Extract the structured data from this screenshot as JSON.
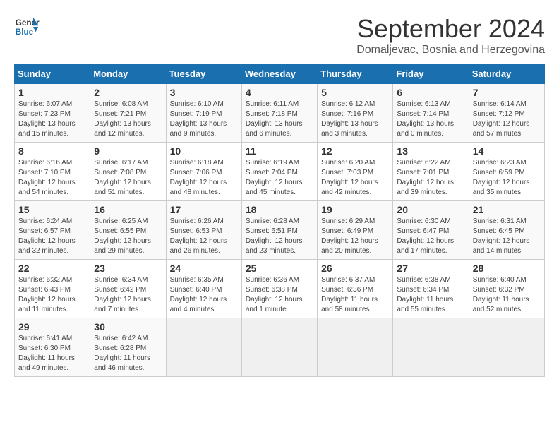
{
  "header": {
    "logo_line1": "General",
    "logo_line2": "Blue",
    "month_title": "September 2024",
    "location": "Domaljevac, Bosnia and Herzegovina"
  },
  "weekdays": [
    "Sunday",
    "Monday",
    "Tuesday",
    "Wednesday",
    "Thursday",
    "Friday",
    "Saturday"
  ],
  "weeks": [
    [
      {
        "day": "1",
        "sunrise": "Sunrise: 6:07 AM",
        "sunset": "Sunset: 7:23 PM",
        "daylight": "Daylight: 13 hours and 15 minutes."
      },
      {
        "day": "2",
        "sunrise": "Sunrise: 6:08 AM",
        "sunset": "Sunset: 7:21 PM",
        "daylight": "Daylight: 13 hours and 12 minutes."
      },
      {
        "day": "3",
        "sunrise": "Sunrise: 6:10 AM",
        "sunset": "Sunset: 7:19 PM",
        "daylight": "Daylight: 13 hours and 9 minutes."
      },
      {
        "day": "4",
        "sunrise": "Sunrise: 6:11 AM",
        "sunset": "Sunset: 7:18 PM",
        "daylight": "Daylight: 13 hours and 6 minutes."
      },
      {
        "day": "5",
        "sunrise": "Sunrise: 6:12 AM",
        "sunset": "Sunset: 7:16 PM",
        "daylight": "Daylight: 13 hours and 3 minutes."
      },
      {
        "day": "6",
        "sunrise": "Sunrise: 6:13 AM",
        "sunset": "Sunset: 7:14 PM",
        "daylight": "Daylight: 13 hours and 0 minutes."
      },
      {
        "day": "7",
        "sunrise": "Sunrise: 6:14 AM",
        "sunset": "Sunset: 7:12 PM",
        "daylight": "Daylight: 12 hours and 57 minutes."
      }
    ],
    [
      {
        "day": "8",
        "sunrise": "Sunrise: 6:16 AM",
        "sunset": "Sunset: 7:10 PM",
        "daylight": "Daylight: 12 hours and 54 minutes."
      },
      {
        "day": "9",
        "sunrise": "Sunrise: 6:17 AM",
        "sunset": "Sunset: 7:08 PM",
        "daylight": "Daylight: 12 hours and 51 minutes."
      },
      {
        "day": "10",
        "sunrise": "Sunrise: 6:18 AM",
        "sunset": "Sunset: 7:06 PM",
        "daylight": "Daylight: 12 hours and 48 minutes."
      },
      {
        "day": "11",
        "sunrise": "Sunrise: 6:19 AM",
        "sunset": "Sunset: 7:04 PM",
        "daylight": "Daylight: 12 hours and 45 minutes."
      },
      {
        "day": "12",
        "sunrise": "Sunrise: 6:20 AM",
        "sunset": "Sunset: 7:03 PM",
        "daylight": "Daylight: 12 hours and 42 minutes."
      },
      {
        "day": "13",
        "sunrise": "Sunrise: 6:22 AM",
        "sunset": "Sunset: 7:01 PM",
        "daylight": "Daylight: 12 hours and 39 minutes."
      },
      {
        "day": "14",
        "sunrise": "Sunrise: 6:23 AM",
        "sunset": "Sunset: 6:59 PM",
        "daylight": "Daylight: 12 hours and 35 minutes."
      }
    ],
    [
      {
        "day": "15",
        "sunrise": "Sunrise: 6:24 AM",
        "sunset": "Sunset: 6:57 PM",
        "daylight": "Daylight: 12 hours and 32 minutes."
      },
      {
        "day": "16",
        "sunrise": "Sunrise: 6:25 AM",
        "sunset": "Sunset: 6:55 PM",
        "daylight": "Daylight: 12 hours and 29 minutes."
      },
      {
        "day": "17",
        "sunrise": "Sunrise: 6:26 AM",
        "sunset": "Sunset: 6:53 PM",
        "daylight": "Daylight: 12 hours and 26 minutes."
      },
      {
        "day": "18",
        "sunrise": "Sunrise: 6:28 AM",
        "sunset": "Sunset: 6:51 PM",
        "daylight": "Daylight: 12 hours and 23 minutes."
      },
      {
        "day": "19",
        "sunrise": "Sunrise: 6:29 AM",
        "sunset": "Sunset: 6:49 PM",
        "daylight": "Daylight: 12 hours and 20 minutes."
      },
      {
        "day": "20",
        "sunrise": "Sunrise: 6:30 AM",
        "sunset": "Sunset: 6:47 PM",
        "daylight": "Daylight: 12 hours and 17 minutes."
      },
      {
        "day": "21",
        "sunrise": "Sunrise: 6:31 AM",
        "sunset": "Sunset: 6:45 PM",
        "daylight": "Daylight: 12 hours and 14 minutes."
      }
    ],
    [
      {
        "day": "22",
        "sunrise": "Sunrise: 6:32 AM",
        "sunset": "Sunset: 6:43 PM",
        "daylight": "Daylight: 12 hours and 11 minutes."
      },
      {
        "day": "23",
        "sunrise": "Sunrise: 6:34 AM",
        "sunset": "Sunset: 6:42 PM",
        "daylight": "Daylight: 12 hours and 7 minutes."
      },
      {
        "day": "24",
        "sunrise": "Sunrise: 6:35 AM",
        "sunset": "Sunset: 6:40 PM",
        "daylight": "Daylight: 12 hours and 4 minutes."
      },
      {
        "day": "25",
        "sunrise": "Sunrise: 6:36 AM",
        "sunset": "Sunset: 6:38 PM",
        "daylight": "Daylight: 12 hours and 1 minute."
      },
      {
        "day": "26",
        "sunrise": "Sunrise: 6:37 AM",
        "sunset": "Sunset: 6:36 PM",
        "daylight": "Daylight: 11 hours and 58 minutes."
      },
      {
        "day": "27",
        "sunrise": "Sunrise: 6:38 AM",
        "sunset": "Sunset: 6:34 PM",
        "daylight": "Daylight: 11 hours and 55 minutes."
      },
      {
        "day": "28",
        "sunrise": "Sunrise: 6:40 AM",
        "sunset": "Sunset: 6:32 PM",
        "daylight": "Daylight: 11 hours and 52 minutes."
      }
    ],
    [
      {
        "day": "29",
        "sunrise": "Sunrise: 6:41 AM",
        "sunset": "Sunset: 6:30 PM",
        "daylight": "Daylight: 11 hours and 49 minutes."
      },
      {
        "day": "30",
        "sunrise": "Sunrise: 6:42 AM",
        "sunset": "Sunset: 6:28 PM",
        "daylight": "Daylight: 11 hours and 46 minutes."
      },
      null,
      null,
      null,
      null,
      null
    ]
  ]
}
